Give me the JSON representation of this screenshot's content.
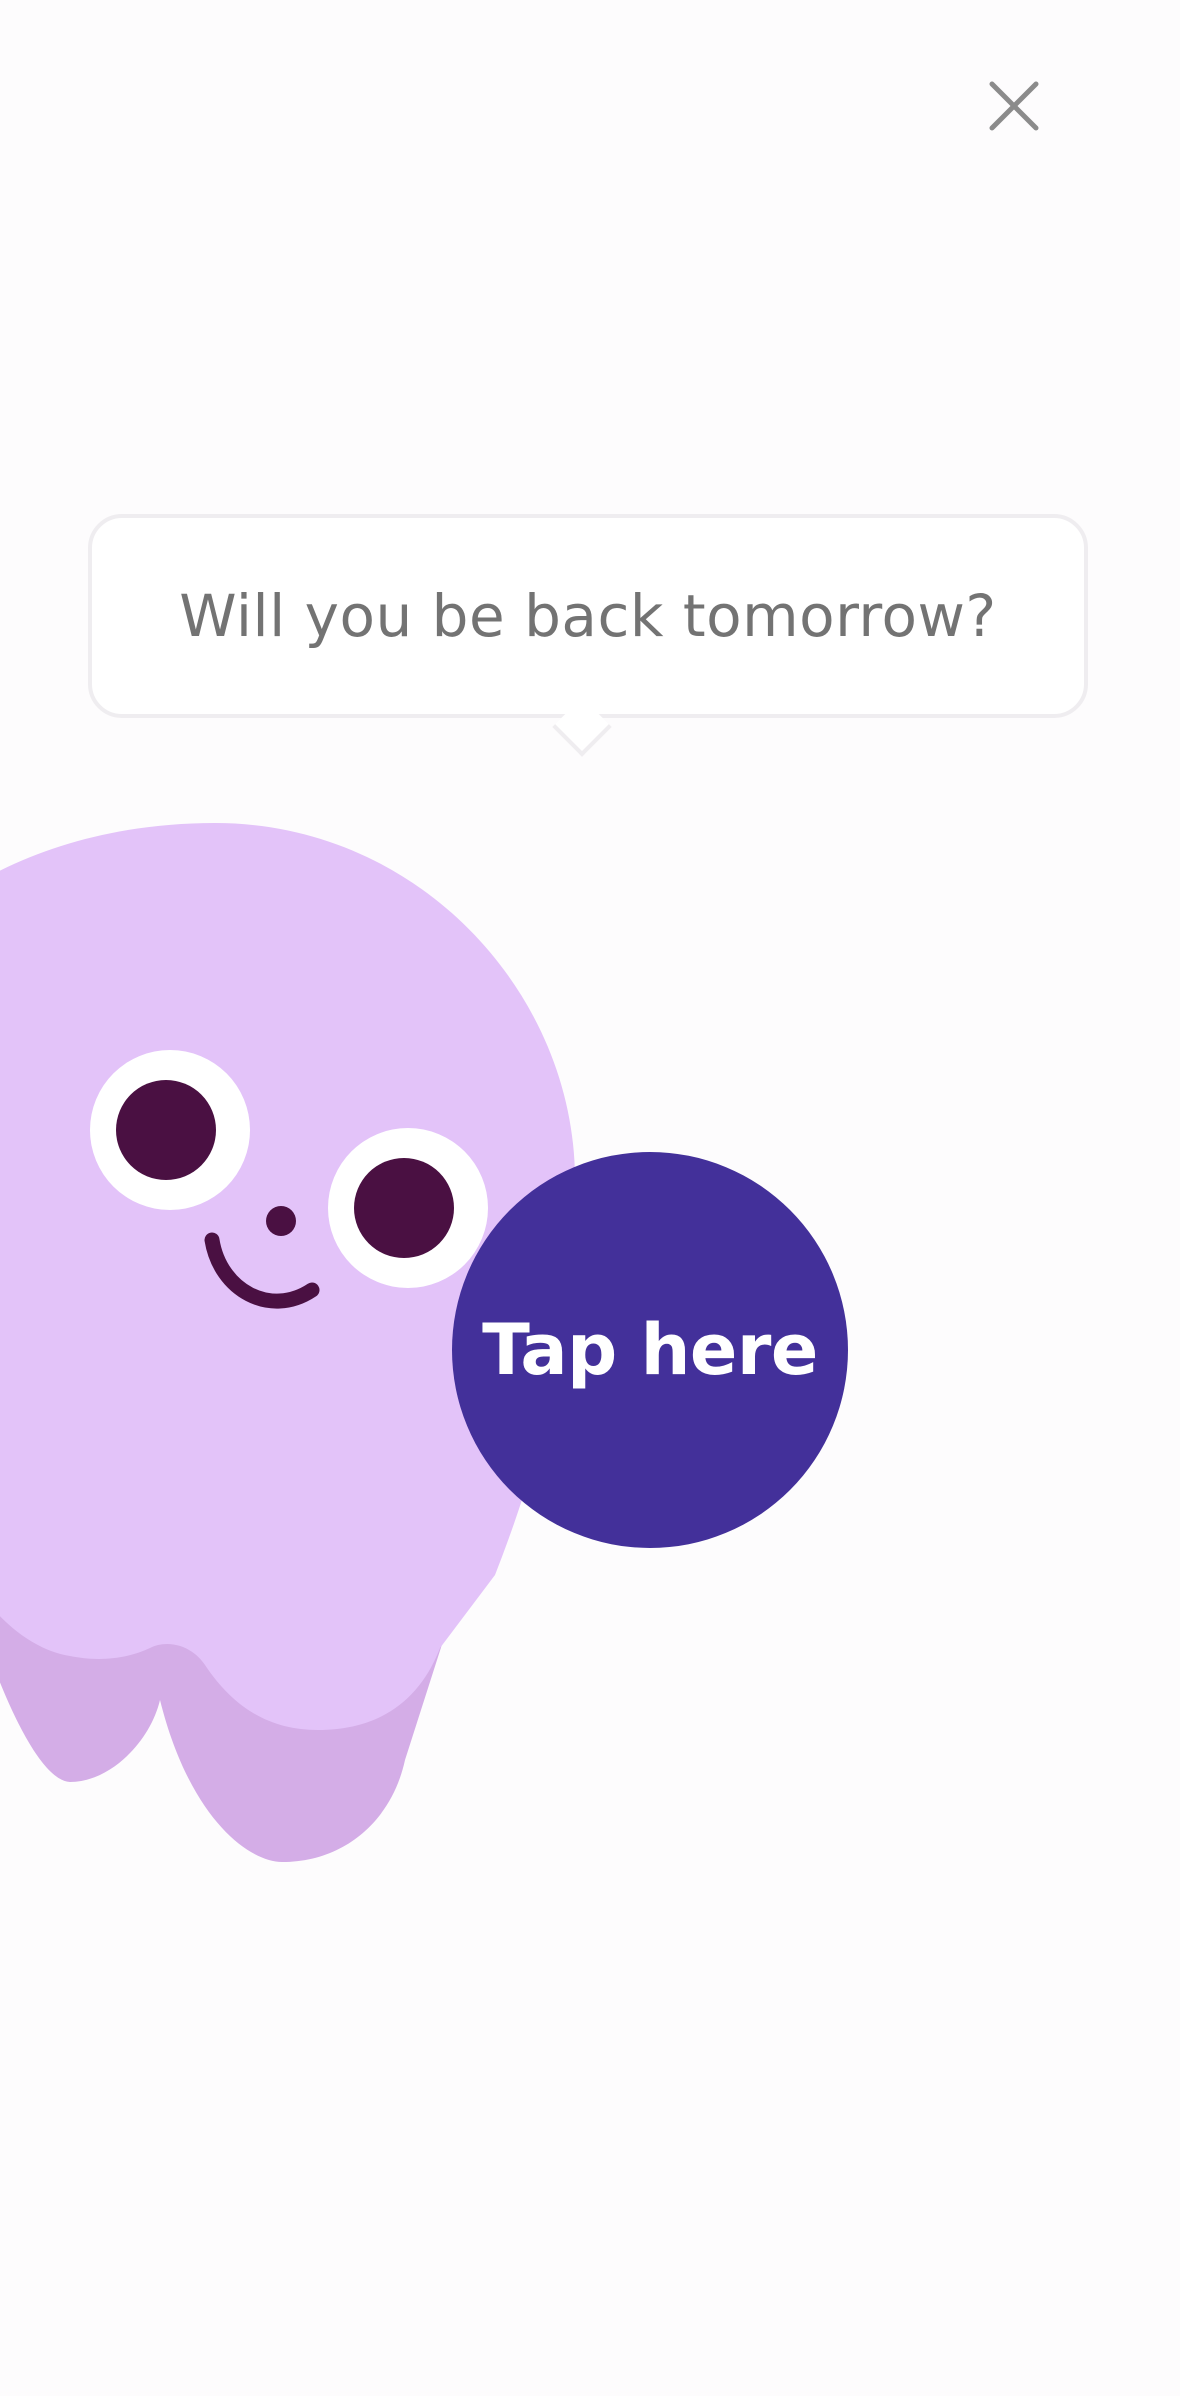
{
  "close": {
    "icon": "close-icon"
  },
  "bubble": {
    "text": "Will you be back tomorrow?"
  },
  "cta": {
    "label": "Tap here"
  },
  "colors": {
    "background": "#fdfcfd",
    "ghost_body": "#e3c3f9",
    "ghost_shadow": "#d4ade7",
    "eye_dark": "#4a1042",
    "button": "#43309a",
    "bubble_text": "#737373"
  }
}
